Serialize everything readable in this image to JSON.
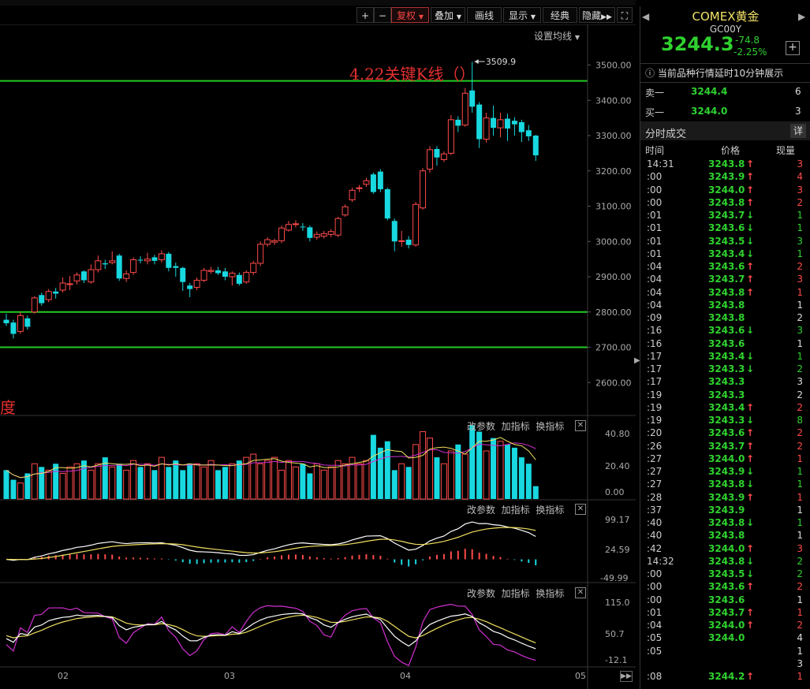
{
  "colors": {
    "up": "#ff4a4a",
    "down": "#18d8e0",
    "hline": "#22cc22",
    "ma_white": "#ffffff",
    "ma_yellow": "#f0e060",
    "ma_magenta": "#d030d0",
    "price_green": "#2fd12f"
  },
  "toolbar": {
    "plus": "+",
    "minus": "−",
    "fuquan": "复权",
    "diejia": "叠加",
    "huaxian": "画线",
    "xianshi": "显示",
    "jingdian": "经典",
    "yincang": "隐藏",
    "expand_icon": "expand-icon"
  },
  "main_chart": {
    "settings_label": "设置均线",
    "annotation": "4.22关键K线（）",
    "high_label": "3509.9",
    "partial_label": "度",
    "y_ticks": [
      "3500.00",
      "3400.00",
      "3300.00",
      "3200.00",
      "3100.00",
      "3000.00",
      "2900.00",
      "2800.00",
      "2700.00",
      "2600.00"
    ],
    "x_ticks": [
      "02",
      "03",
      "04",
      "05"
    ]
  },
  "panels": {
    "change_params": "改参数",
    "add_indicator": "加指标",
    "switch_indicator": "换指标",
    "volume_ticks": [
      "40.80",
      "20.40",
      "0.00"
    ],
    "macd_ticks": [
      "99.17",
      "24.59",
      "-49.99"
    ],
    "kdj_ticks": [
      "115.0",
      "50.7",
      "-12.1"
    ]
  },
  "chart_data": {
    "type": "candlestick",
    "title": "",
    "ylim": [
      2560,
      3580
    ],
    "candles": [
      {
        "o": 2778,
        "c": 2768,
        "h": 2795,
        "l": 2760
      },
      {
        "o": 2770,
        "c": 2738,
        "h": 2778,
        "l": 2725
      },
      {
        "o": 2745,
        "c": 2790,
        "h": 2800,
        "l": 2738
      },
      {
        "o": 2782,
        "c": 2758,
        "h": 2790,
        "l": 2750
      },
      {
        "o": 2800,
        "c": 2840,
        "h": 2845,
        "l": 2795
      },
      {
        "o": 2848,
        "c": 2825,
        "h": 2855,
        "l": 2818
      },
      {
        "o": 2835,
        "c": 2858,
        "h": 2865,
        "l": 2828
      },
      {
        "o": 2858,
        "c": 2852,
        "h": 2868,
        "l": 2838
      },
      {
        "o": 2862,
        "c": 2882,
        "h": 2898,
        "l": 2855
      },
      {
        "o": 2878,
        "c": 2880,
        "h": 2902,
        "l": 2862
      },
      {
        "o": 2888,
        "c": 2905,
        "h": 2912,
        "l": 2878
      },
      {
        "o": 2915,
        "c": 2890,
        "h": 2918,
        "l": 2882
      },
      {
        "o": 2885,
        "c": 2920,
        "h": 2935,
        "l": 2880
      },
      {
        "o": 2920,
        "c": 2945,
        "h": 2960,
        "l": 2912
      },
      {
        "o": 2938,
        "c": 2935,
        "h": 2948,
        "l": 2922
      },
      {
        "o": 2940,
        "c": 2945,
        "h": 2972,
        "l": 2935
      },
      {
        "o": 2960,
        "c": 2895,
        "h": 2965,
        "l": 2888
      },
      {
        "o": 2895,
        "c": 2908,
        "h": 2918,
        "l": 2885
      },
      {
        "o": 2912,
        "c": 2948,
        "h": 2955,
        "l": 2905
      },
      {
        "o": 2948,
        "c": 2946,
        "h": 2958,
        "l": 2938
      },
      {
        "o": 2945,
        "c": 2950,
        "h": 2968,
        "l": 2935
      },
      {
        "o": 2955,
        "c": 2945,
        "h": 2962,
        "l": 2935
      },
      {
        "o": 2948,
        "c": 2965,
        "h": 2975,
        "l": 2940
      },
      {
        "o": 2965,
        "c": 2925,
        "h": 2970,
        "l": 2915
      },
      {
        "o": 2930,
        "c": 2925,
        "h": 2940,
        "l": 2900
      },
      {
        "o": 2925,
        "c": 2885,
        "h": 2928,
        "l": 2860
      },
      {
        "o": 2875,
        "c": 2865,
        "h": 2882,
        "l": 2842
      },
      {
        "o": 2870,
        "c": 2890,
        "h": 2898,
        "l": 2862
      },
      {
        "o": 2890,
        "c": 2918,
        "h": 2925,
        "l": 2885
      },
      {
        "o": 2915,
        "c": 2918,
        "h": 2928,
        "l": 2908
      },
      {
        "o": 2918,
        "c": 2910,
        "h": 2928,
        "l": 2905
      },
      {
        "o": 2915,
        "c": 2900,
        "h": 2925,
        "l": 2890
      },
      {
        "o": 2900,
        "c": 2910,
        "h": 2915,
        "l": 2875
      },
      {
        "o": 2905,
        "c": 2880,
        "h": 2912,
        "l": 2875
      },
      {
        "o": 2885,
        "c": 2912,
        "h": 2918,
        "l": 2880
      },
      {
        "o": 2912,
        "c": 2938,
        "h": 2945,
        "l": 2905
      },
      {
        "o": 2938,
        "c": 2992,
        "h": 3000,
        "l": 2930
      },
      {
        "o": 2992,
        "c": 3005,
        "h": 3012,
        "l": 2985
      },
      {
        "o": 2998,
        "c": 3002,
        "h": 3008,
        "l": 2990
      },
      {
        "o": 3002,
        "c": 3038,
        "h": 3045,
        "l": 2995
      },
      {
        "o": 3032,
        "c": 3048,
        "h": 3058,
        "l": 3028
      },
      {
        "o": 3050,
        "c": 3050,
        "h": 3060,
        "l": 3040
      },
      {
        "o": 3042,
        "c": 3040,
        "h": 3052,
        "l": 3030
      },
      {
        "o": 3040,
        "c": 3010,
        "h": 3045,
        "l": 3000
      },
      {
        "o": 3012,
        "c": 3020,
        "h": 3028,
        "l": 3005
      },
      {
        "o": 3015,
        "c": 3022,
        "h": 3030,
        "l": 3008
      },
      {
        "o": 3020,
        "c": 3028,
        "h": 3035,
        "l": 3012
      },
      {
        "o": 3018,
        "c": 3065,
        "h": 3070,
        "l": 3012
      },
      {
        "o": 3075,
        "c": 3098,
        "h": 3105,
        "l": 3070
      },
      {
        "o": 3118,
        "c": 3145,
        "h": 3152,
        "l": 3112
      },
      {
        "o": 3150,
        "c": 3152,
        "h": 3160,
        "l": 3140
      },
      {
        "o": 3162,
        "c": 3172,
        "h": 3180,
        "l": 3155
      },
      {
        "o": 3190,
        "c": 3140,
        "h": 3195,
        "l": 3135
      },
      {
        "o": 3198,
        "c": 3148,
        "h": 3205,
        "l": 3140
      },
      {
        "o": 3148,
        "c": 3065,
        "h": 3152,
        "l": 3060
      },
      {
        "o": 3058,
        "c": 3000,
        "h": 3065,
        "l": 2972
      },
      {
        "o": 3002,
        "c": 3002,
        "h": 3030,
        "l": 2985
      },
      {
        "o": 3005,
        "c": 2990,
        "h": 3015,
        "l": 2980
      },
      {
        "o": 2990,
        "c": 3105,
        "h": 3112,
        "l": 2985
      },
      {
        "o": 3095,
        "c": 3200,
        "h": 3208,
        "l": 3090
      },
      {
        "o": 3205,
        "c": 3260,
        "h": 3270,
        "l": 3195
      },
      {
        "o": 3262,
        "c": 3238,
        "h": 3270,
        "l": 3215
      },
      {
        "o": 3232,
        "c": 3248,
        "h": 3255,
        "l": 3225
      },
      {
        "o": 3250,
        "c": 3345,
        "h": 3358,
        "l": 3245
      },
      {
        "o": 3345,
        "c": 3328,
        "h": 3355,
        "l": 3310
      },
      {
        "o": 3330,
        "c": 3420,
        "h": 3435,
        "l": 3325
      },
      {
        "o": 3428,
        "c": 3382,
        "h": 3509,
        "l": 3365
      },
      {
        "o": 3388,
        "c": 3290,
        "h": 3395,
        "l": 3265
      },
      {
        "o": 3290,
        "c": 3350,
        "h": 3365,
        "l": 3280
      },
      {
        "o": 3350,
        "c": 3322,
        "h": 3385,
        "l": 3300
      },
      {
        "o": 3322,
        "c": 3345,
        "h": 3365,
        "l": 3295
      },
      {
        "o": 3348,
        "c": 3320,
        "h": 3362,
        "l": 3285
      },
      {
        "o": 3342,
        "c": 3332,
        "h": 3352,
        "l": 3300
      },
      {
        "o": 3338,
        "c": 3310,
        "h": 3345,
        "l": 3282
      },
      {
        "o": 3315,
        "c": 3298,
        "h": 3330,
        "l": 3285
      },
      {
        "o": 3300,
        "c": 3244,
        "h": 3302,
        "l": 3228
      }
    ],
    "volume": [
      18,
      12,
      10,
      16,
      22,
      20,
      18,
      22,
      16,
      20,
      22,
      24,
      18,
      22,
      26,
      20,
      22,
      18,
      24,
      20,
      22,
      18,
      26,
      20,
      24,
      18,
      22,
      22,
      20,
      24,
      18,
      20,
      22,
      24,
      26,
      28,
      22,
      24,
      26,
      18,
      24,
      20,
      22,
      16,
      22,
      18,
      20,
      24,
      22,
      26,
      22,
      24,
      40,
      32,
      36,
      18,
      22,
      20,
      34,
      42,
      38,
      26,
      22,
      30,
      34,
      28,
      46,
      42,
      30,
      38,
      36,
      34,
      32,
      26,
      22,
      8
    ],
    "horizontal_lines": [
      3455,
      2800,
      2700
    ],
    "high_marker": 3509.9
  },
  "right_panel": {
    "title": "COMEX黄金",
    "code": "GC00Y",
    "price": "3244.3",
    "change": "-74.8",
    "change_pct": "-2.25%",
    "plus_icon": "+",
    "notice": "当前品种行情延时10分钟展示",
    "sell_label": "卖一",
    "sell_price": "3244.4",
    "sell_vol": "6",
    "buy_label": "买一",
    "buy_price": "3244.0",
    "buy_vol": "3",
    "section_title": "分时成交",
    "detail_btn": "详",
    "col_time": "时间",
    "col_price": "价格",
    "col_vol": "现量",
    "trades": [
      {
        "t": "14:31",
        "p": "3243.8",
        "a": "↑",
        "v": "3"
      },
      {
        "t": ":00",
        "p": "3243.9",
        "a": "↑",
        "v": "4"
      },
      {
        "t": ":00",
        "p": "3244.0",
        "a": "↑",
        "v": "3"
      },
      {
        "t": ":00",
        "p": "3243.8",
        "a": "↑",
        "v": "2"
      },
      {
        "t": ":01",
        "p": "3243.7",
        "a": "↓",
        "v": "1"
      },
      {
        "t": ":01",
        "p": "3243.6",
        "a": "↓",
        "v": "1"
      },
      {
        "t": ":01",
        "p": "3243.5",
        "a": "↓",
        "v": "3"
      },
      {
        "t": ":01",
        "p": "3243.4",
        "a": "↓",
        "v": "1"
      },
      {
        "t": ":04",
        "p": "3243.6",
        "a": "↑",
        "v": "2"
      },
      {
        "t": ":04",
        "p": "3243.7",
        "a": "↑",
        "v": "3"
      },
      {
        "t": ":04",
        "p": "3243.8",
        "a": "↑",
        "v": "1"
      },
      {
        "t": ":04",
        "p": "3243.8",
        "a": "",
        "v": "1"
      },
      {
        "t": ":09",
        "p": "3243.8",
        "a": "",
        "v": "2"
      },
      {
        "t": ":16",
        "p": "3243.6",
        "a": "↓",
        "v": "3"
      },
      {
        "t": ":16",
        "p": "3243.6",
        "a": "",
        "v": "1"
      },
      {
        "t": ":17",
        "p": "3243.4",
        "a": "↓",
        "v": "1"
      },
      {
        "t": ":17",
        "p": "3243.3",
        "a": "↓",
        "v": "2"
      },
      {
        "t": ":17",
        "p": "3243.3",
        "a": "",
        "v": "3"
      },
      {
        "t": ":19",
        "p": "3243.3",
        "a": "",
        "v": "2"
      },
      {
        "t": ":19",
        "p": "3243.4",
        "a": "↑",
        "v": "2"
      },
      {
        "t": ":19",
        "p": "3243.3",
        "a": "↓",
        "v": "8"
      },
      {
        "t": ":20",
        "p": "3243.6",
        "a": "↑",
        "v": "2"
      },
      {
        "t": ":26",
        "p": "3243.7",
        "a": "↑",
        "v": "2"
      },
      {
        "t": ":27",
        "p": "3244.0",
        "a": "↑",
        "v": "1"
      },
      {
        "t": ":27",
        "p": "3243.9",
        "a": "↓",
        "v": "1"
      },
      {
        "t": ":27",
        "p": "3243.8",
        "a": "↓",
        "v": "1"
      },
      {
        "t": ":28",
        "p": "3243.9",
        "a": "↑",
        "v": "1"
      },
      {
        "t": ":37",
        "p": "3243.9",
        "a": "",
        "v": "1"
      },
      {
        "t": ":40",
        "p": "3243.8",
        "a": "↓",
        "v": "1"
      },
      {
        "t": ":40",
        "p": "3243.8",
        "a": "",
        "v": "1"
      },
      {
        "t": ":42",
        "p": "3244.0",
        "a": "↑",
        "v": "3"
      },
      {
        "t": "14:32",
        "p": "3243.8",
        "a": "↓",
        "v": "2"
      },
      {
        "t": ":00",
        "p": "3243.5",
        "a": "↓",
        "v": "2"
      },
      {
        "t": ":00",
        "p": "3243.6",
        "a": "↑",
        "v": "2"
      },
      {
        "t": ":00",
        "p": "3243.6",
        "a": "",
        "v": "1"
      },
      {
        "t": ":01",
        "p": "3243.7",
        "a": "↑",
        "v": "1"
      },
      {
        "t": ":04",
        "p": "3244.0",
        "a": "↑",
        "v": "2"
      },
      {
        "t": ":05",
        "p": "3244.0",
        "a": "",
        "v": "4"
      },
      {
        "t": ":05",
        "p": "",
        "a": "",
        "v": "1"
      },
      {
        "t": "",
        "p": "",
        "a": "",
        "v": "3"
      },
      {
        "t": ":08",
        "p": "3244.2",
        "a": "↑",
        "v": "1"
      }
    ]
  }
}
